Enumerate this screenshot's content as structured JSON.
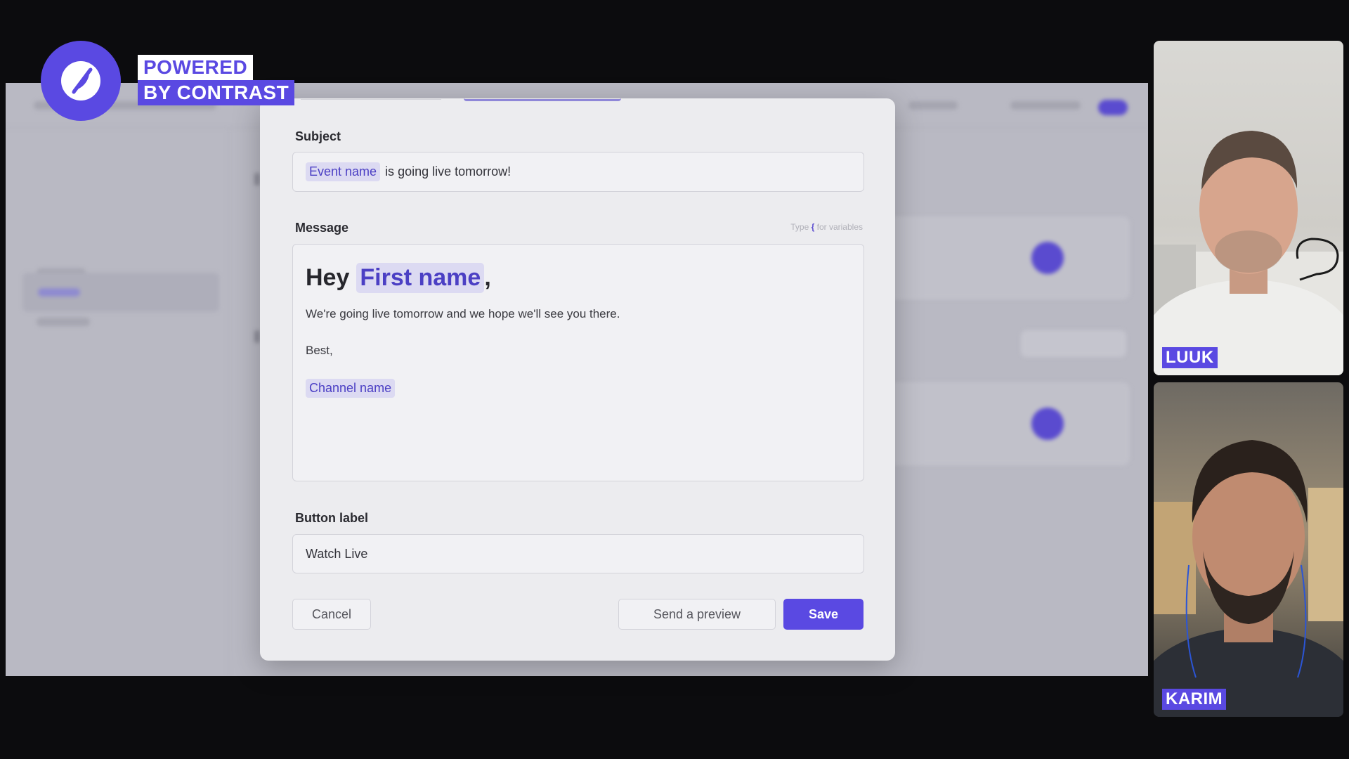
{
  "branding": {
    "line1": "POWERED",
    "line2": "BY CONTRAST",
    "accent_color": "#5a49e2"
  },
  "modal": {
    "subject": {
      "label": "Subject",
      "variable": "Event name",
      "text": "is going live tomorrow!"
    },
    "message": {
      "label": "Message",
      "hint_prefix": "Type",
      "hint_key": "{",
      "hint_suffix": "for variables",
      "greeting": "Hey",
      "greeting_variable": "First name",
      "greeting_punct": ",",
      "body": "We're going live tomorrow and we hope we'll see you there.",
      "signoff": "Best,",
      "signature_variable": "Channel name"
    },
    "button_label": {
      "label": "Button label",
      "value": "Watch Live"
    },
    "actions": {
      "cancel": "Cancel",
      "preview": "Send a preview",
      "save": "Save"
    }
  },
  "participants": [
    {
      "name": "LUUK"
    },
    {
      "name": "KARIM"
    }
  ]
}
